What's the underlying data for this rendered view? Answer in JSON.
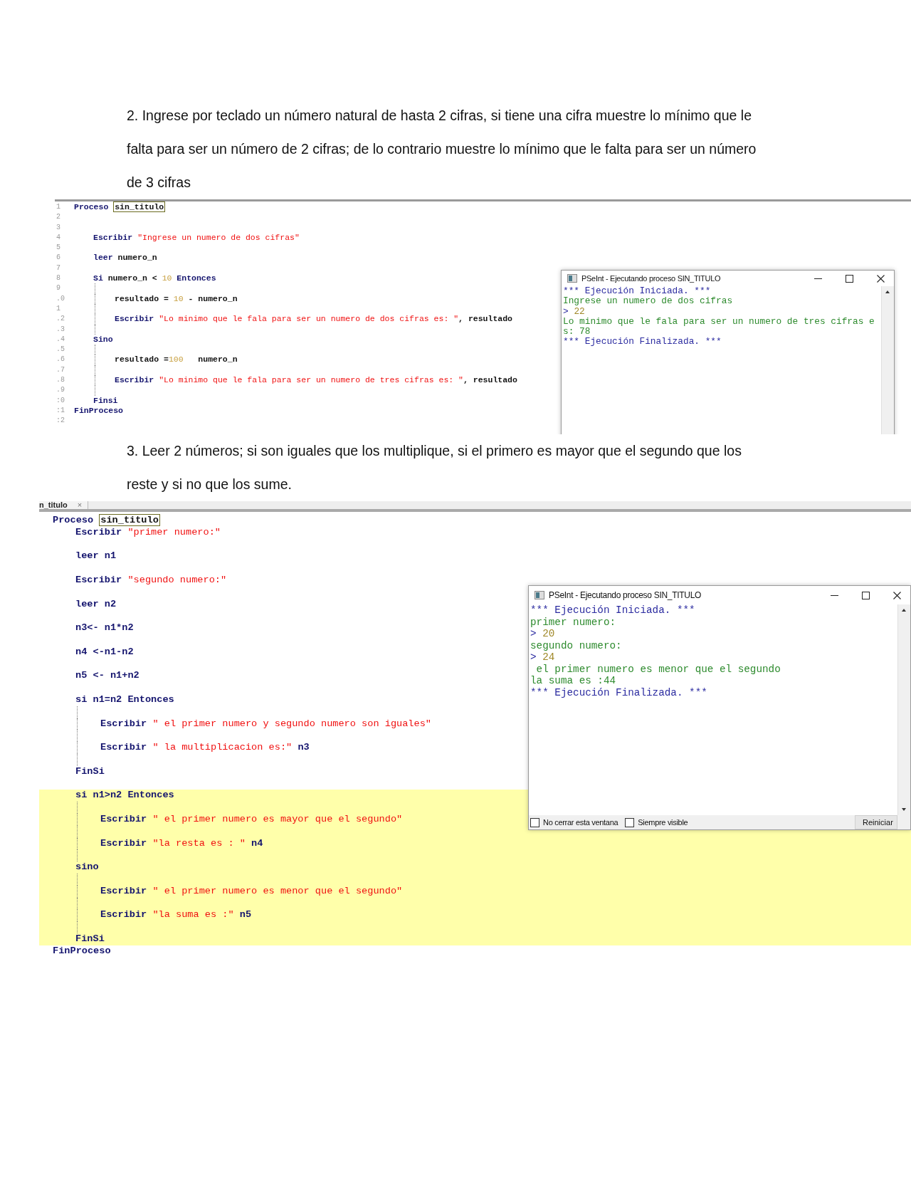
{
  "exercise_2": {
    "statement": "2. Ingrese por teclado un número natural de hasta 2 cifras, si tiene una cifra muestre lo mínimo que le falta para ser un número de 2 cifras; de lo contrario muestre lo mínimo que le falta para ser un número de 3 cifras",
    "editor": {
      "line_numbers": [
        "1",
        "2",
        "3",
        "4",
        "5",
        "6",
        "7",
        "8",
        "9",
        ".0",
        "1",
        ".2",
        ".3",
        ".4",
        ".5",
        ".6",
        ".7",
        ".8",
        ".9",
        ":0",
        ":1",
        ":2"
      ],
      "lines": [
        {
          "kind": "code",
          "tokens": [
            {
              "kind": "keyword",
              "text": "Proceso "
            },
            {
              "kind": "boxed",
              "text": "sin_titulo"
            }
          ],
          "children": [
            {
              "kind": "blank"
            },
            {
              "kind": "blank"
            },
            {
              "kind": "code",
              "tokens": [
                {
                  "kind": "keyword",
                  "text": "Escribir "
                },
                {
                  "kind": "string",
                  "text": "\"Ingrese un numero de dos cifras\""
                }
              ]
            },
            {
              "kind": "blank"
            },
            {
              "kind": "code",
              "tokens": [
                {
                  "kind": "keyword",
                  "text": "leer "
                },
                {
                  "kind": "plain",
                  "text": "numero_n"
                }
              ]
            },
            {
              "kind": "blank"
            },
            {
              "kind": "code",
              "tokens": [
                {
                  "kind": "keyword",
                  "text": "Si "
                },
                {
                  "kind": "plain",
                  "text": "numero_n < "
                },
                {
                  "kind": "number",
                  "text": "10"
                },
                {
                  "kind": "keyword",
                  "text": " Entonces"
                }
              ],
              "children": [
                {
                  "kind": "blank"
                },
                {
                  "kind": "code",
                  "tokens": [
                    {
                      "kind": "plain",
                      "text": "resultado = "
                    },
                    {
                      "kind": "number",
                      "text": "10"
                    },
                    {
                      "kind": "plain",
                      "text": " - numero_n"
                    }
                  ]
                },
                {
                  "kind": "blank"
                },
                {
                  "kind": "code",
                  "tokens": [
                    {
                      "kind": "keyword",
                      "text": "Escribir "
                    },
                    {
                      "kind": "string",
                      "text": "\"Lo minimo que le fala para ser un numero de dos cifras es: \""
                    },
                    {
                      "kind": "plain",
                      "text": ", resultado"
                    }
                  ]
                },
                {
                  "kind": "blank"
                }
              ]
            },
            {
              "kind": "code",
              "tokens": [
                {
                  "kind": "keyword",
                  "text": "Sino"
                }
              ],
              "children": [
                {
                  "kind": "blank"
                },
                {
                  "kind": "code",
                  "tokens": [
                    {
                      "kind": "plain",
                      "text": "resultado ="
                    },
                    {
                      "kind": "number",
                      "text": "100"
                    },
                    {
                      "kind": "plain",
                      "text": "   numero_n"
                    }
                  ]
                },
                {
                  "kind": "blank"
                },
                {
                  "kind": "code",
                  "tokens": [
                    {
                      "kind": "keyword",
                      "text": "Escribir "
                    },
                    {
                      "kind": "string",
                      "text": "\"Lo minimo que le fala para ser un numero de tres cifras es: \""
                    },
                    {
                      "kind": "plain",
                      "text": ", resultado"
                    }
                  ]
                },
                {
                  "kind": "blank"
                }
              ]
            },
            {
              "kind": "code",
              "tokens": [
                {
                  "kind": "keyword",
                  "text": "Finsi"
                }
              ]
            }
          ]
        },
        {
          "kind": "code",
          "tokens": [
            {
              "kind": "keyword",
              "text": "FinProceso"
            }
          ]
        },
        {
          "kind": "blank"
        }
      ]
    },
    "console": {
      "title": "PSeInt - Ejecutando proceso SIN_TITULO",
      "lines": [
        {
          "kind": "banner",
          "text": "*** Ejecución Iniciada. ***"
        },
        {
          "kind": "output",
          "text": "Ingrese un numero de dos cifras"
        },
        {
          "kind": "input",
          "prompt": ">",
          "text": "22"
        },
        {
          "kind": "output",
          "text": "Lo minimo que le fala para ser un numero de tres cifras e"
        },
        {
          "kind": "output",
          "text": "s: 78"
        },
        {
          "kind": "banner",
          "text": "*** Ejecución Finalizada. ***"
        }
      ]
    }
  },
  "exercise_3": {
    "statement": "3. Leer 2 números; si son iguales que los multiplique, si el primero es mayor que el segundo que los reste y si no que los sume.",
    "editor": {
      "tab": {
        "label": "n_titulo",
        "close": "×"
      },
      "lines": [
        {
          "kind": "code",
          "highlighted": false,
          "tokens": [
            {
              "kind": "keyword",
              "text": "Proceso "
            },
            {
              "kind": "boxed",
              "text": "sin_titulo"
            }
          ],
          "children": [
            {
              "kind": "code",
              "highlighted": false,
              "tokens": [
                {
                  "kind": "keyword",
                  "text": "Escribir "
                },
                {
                  "kind": "string",
                  "text": "\"primer numero:\""
                }
              ]
            },
            {
              "kind": "blank",
              "highlighted": false
            },
            {
              "kind": "code",
              "highlighted": false,
              "tokens": [
                {
                  "kind": "keyword",
                  "text": "leer "
                },
                {
                  "kind": "plain",
                  "text": "n1"
                }
              ]
            },
            {
              "kind": "blank",
              "highlighted": false
            },
            {
              "kind": "code",
              "highlighted": false,
              "tokens": [
                {
                  "kind": "keyword",
                  "text": "Escribir "
                },
                {
                  "kind": "string",
                  "text": "\"segundo numero:\""
                }
              ]
            },
            {
              "kind": "blank",
              "highlighted": false
            },
            {
              "kind": "code",
              "highlighted": false,
              "tokens": [
                {
                  "kind": "keyword",
                  "text": "leer "
                },
                {
                  "kind": "plain",
                  "text": "n2"
                }
              ]
            },
            {
              "kind": "blank",
              "highlighted": false
            },
            {
              "kind": "code",
              "highlighted": false,
              "tokens": [
                {
                  "kind": "plain",
                  "text": "n3<- n1*n2"
                }
              ]
            },
            {
              "kind": "blank",
              "highlighted": false
            },
            {
              "kind": "code",
              "highlighted": false,
              "tokens": [
                {
                  "kind": "plain",
                  "text": "n4 <-n1-n2"
                }
              ]
            },
            {
              "kind": "blank",
              "highlighted": false
            },
            {
              "kind": "code",
              "highlighted": false,
              "tokens": [
                {
                  "kind": "plain",
                  "text": "n5 <- n1+n2"
                }
              ]
            },
            {
              "kind": "blank",
              "highlighted": false
            },
            {
              "kind": "code",
              "highlighted": false,
              "tokens": [
                {
                  "kind": "keyword",
                  "text": "si "
                },
                {
                  "kind": "plain",
                  "text": "n1=n2 "
                },
                {
                  "kind": "keyword",
                  "text": "Entonces"
                }
              ],
              "children": [
                {
                  "kind": "blank",
                  "highlighted": false
                },
                {
                  "kind": "code",
                  "highlighted": false,
                  "tokens": [
                    {
                      "kind": "keyword",
                      "text": "Escribir "
                    },
                    {
                      "kind": "string",
                      "text": "\" el primer numero y segundo numero son iguales\""
                    }
                  ]
                },
                {
                  "kind": "blank",
                  "highlighted": false
                },
                {
                  "kind": "code",
                  "highlighted": false,
                  "tokens": [
                    {
                      "kind": "keyword",
                      "text": "Escribir "
                    },
                    {
                      "kind": "string",
                      "text": "\" la multiplicacion es:\""
                    },
                    {
                      "kind": "plain",
                      "text": " n3"
                    }
                  ]
                },
                {
                  "kind": "blank",
                  "highlighted": false
                }
              ]
            },
            {
              "kind": "code",
              "highlighted": false,
              "tokens": [
                {
                  "kind": "keyword",
                  "text": "FinSi"
                }
              ]
            },
            {
              "kind": "blank",
              "highlighted": false
            },
            {
              "kind": "code",
              "highlighted": true,
              "tokens": [
                {
                  "kind": "keyword",
                  "text": "si "
                },
                {
                  "kind": "plain",
                  "text": "n1>n2 "
                },
                {
                  "kind": "keyword",
                  "text": "Entonces"
                }
              ],
              "children": [
                {
                  "kind": "blank",
                  "highlighted": true
                },
                {
                  "kind": "code",
                  "highlighted": true,
                  "tokens": [
                    {
                      "kind": "keyword",
                      "text": "Escribir "
                    },
                    {
                      "kind": "string",
                      "text": "\" el primer numero es mayor que el segundo\""
                    }
                  ]
                },
                {
                  "kind": "blank",
                  "highlighted": true
                },
                {
                  "kind": "code",
                  "highlighted": true,
                  "tokens": [
                    {
                      "kind": "keyword",
                      "text": "Escribir "
                    },
                    {
                      "kind": "string",
                      "text": "\"la resta es : \""
                    },
                    {
                      "kind": "plain",
                      "text": " n4"
                    }
                  ]
                },
                {
                  "kind": "blank",
                  "highlighted": true
                }
              ]
            },
            {
              "kind": "code",
              "highlighted": true,
              "tokens": [
                {
                  "kind": "keyword",
                  "text": "sino"
                }
              ],
              "children": [
                {
                  "kind": "blank",
                  "highlighted": true
                },
                {
                  "kind": "code",
                  "highlighted": true,
                  "tokens": [
                    {
                      "kind": "keyword",
                      "text": "Escribir "
                    },
                    {
                      "kind": "string",
                      "text": "\" el primer numero es menor que el segundo\""
                    }
                  ]
                },
                {
                  "kind": "blank",
                  "highlighted": true
                },
                {
                  "kind": "code",
                  "highlighted": true,
                  "tokens": [
                    {
                      "kind": "keyword",
                      "text": "Escribir "
                    },
                    {
                      "kind": "string",
                      "text": "\"la suma es :\""
                    },
                    {
                      "kind": "plain",
                      "text": " n5"
                    }
                  ]
                },
                {
                  "kind": "blank",
                  "highlighted": true
                }
              ]
            },
            {
              "kind": "code",
              "highlighted": true,
              "tokens": [
                {
                  "kind": "keyword",
                  "text": "FinSi"
                }
              ]
            }
          ]
        },
        {
          "kind": "code",
          "highlighted": false,
          "tokens": [
            {
              "kind": "keyword",
              "text": "FinProceso"
            }
          ]
        }
      ]
    },
    "console": {
      "title": "PSeInt - Ejecutando proceso SIN_TITULO",
      "lines": [
        {
          "kind": "banner",
          "text": "*** Ejecución Iniciada. ***"
        },
        {
          "kind": "output",
          "text": "primer numero:"
        },
        {
          "kind": "input",
          "prompt": ">",
          "text": "20"
        },
        {
          "kind": "output",
          "text": "segundo numero:"
        },
        {
          "kind": "input",
          "prompt": ">",
          "text": "24"
        },
        {
          "kind": "output",
          "text": " el primer numero es menor que el segundo"
        },
        {
          "kind": "output",
          "text": "la suma es :44"
        },
        {
          "kind": "banner",
          "text": "*** Ejecución Finalizada. ***"
        }
      ],
      "options": [
        {
          "label": "No cerrar esta ventana",
          "checked": false
        },
        {
          "label": "Siempre visible",
          "checked": false
        }
      ],
      "button": "Reiniciar"
    }
  }
}
